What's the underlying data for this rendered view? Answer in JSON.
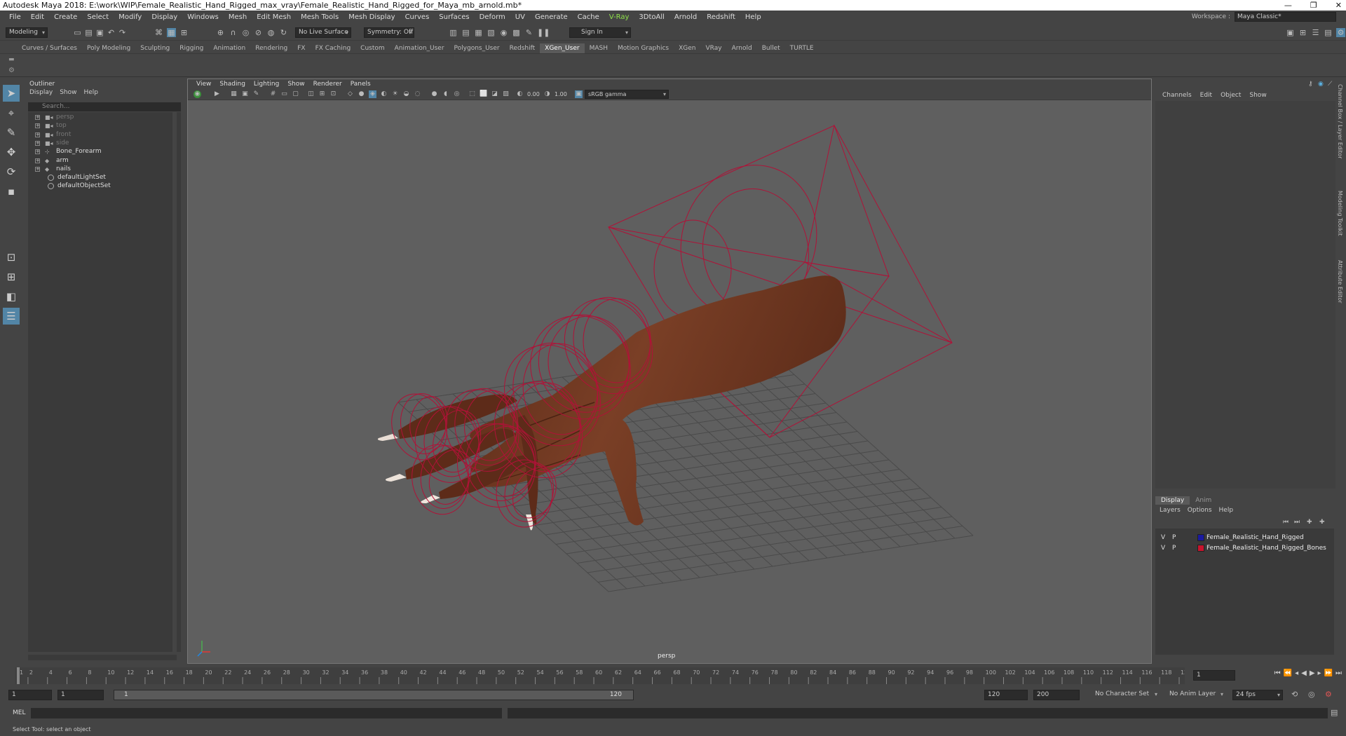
{
  "window": {
    "title": "Autodesk Maya 2018: E:\\work\\WIP\\Female_Realistic_Hand_Rigged_max_vray\\Female_Realistic_Hand_Rigged_for_Maya_mb_arnold.mb*",
    "min": "—",
    "restore": "❐",
    "close": "✕"
  },
  "menubar": [
    "File",
    "Edit",
    "Create",
    "Select",
    "Modify",
    "Display",
    "Windows",
    "Mesh",
    "Edit Mesh",
    "Mesh Tools",
    "Mesh Display",
    "Curves",
    "Surfaces",
    "Deform",
    "UV",
    "Generate",
    "Cache",
    "V-Ray",
    "3DtoAll",
    "Arnold",
    "Redshift",
    "Help"
  ],
  "workspace": {
    "label": "Workspace :",
    "value": "Maya Classic*"
  },
  "statusline": {
    "mode": "Modeling",
    "live_surface": "No Live Surface",
    "symmetry": "Symmetry: Off",
    "sign_in": "Sign In"
  },
  "shelf_tabs": [
    "Curves / Surfaces",
    "Poly Modeling",
    "Sculpting",
    "Rigging",
    "Animation",
    "Rendering",
    "FX",
    "FX Caching",
    "Custom",
    "Animation_User",
    "Polygons_User",
    "Redshift",
    "XGen_User",
    "MASH",
    "Motion Graphics",
    "XGen",
    "VRay",
    "Arnold",
    "Bullet",
    "TURTLE"
  ],
  "shelf_active": "XGen_User",
  "outliner": {
    "title": "Outliner",
    "menu": [
      "Display",
      "Show",
      "Help"
    ],
    "search_placeholder": "Search...",
    "items": [
      {
        "label": "persp",
        "dim": true
      },
      {
        "label": "top",
        "dim": true
      },
      {
        "label": "front",
        "dim": true
      },
      {
        "label": "side",
        "dim": true
      },
      {
        "label": "Bone_Forearm",
        "dim": false
      },
      {
        "label": "arm",
        "dim": false
      },
      {
        "label": "nails",
        "dim": false
      },
      {
        "label": "defaultLightSet",
        "dim": false
      },
      {
        "label": "defaultObjectSet",
        "dim": false
      }
    ]
  },
  "viewport": {
    "menu": [
      "View",
      "Shading",
      "Lighting",
      "Show",
      "Renderer",
      "Panels"
    ],
    "exposure": "0.00",
    "gamma": "1.00",
    "color_space": "sRGB gamma",
    "camera": "persp"
  },
  "channelbox": {
    "menu": [
      "Channels",
      "Edit",
      "Object",
      "Show"
    ]
  },
  "layer_editor": {
    "tabs": [
      "Display",
      "Anim"
    ],
    "menu": [
      "Layers",
      "Options",
      "Help"
    ],
    "layers": [
      {
        "v": "V",
        "p": "P",
        "color": "#1a1aa0",
        "name": "Female_Realistic_Hand_Rigged"
      },
      {
        "v": "V",
        "p": "P",
        "color": "#c8142d",
        "name": "Female_Realistic_Hand_Rigged_Bones"
      }
    ]
  },
  "side_tabs": [
    "Channel Box / Layer Editor",
    "Modeling Toolkit",
    "Attribute Editor"
  ],
  "timeline": {
    "tick_labels": [
      "1",
      "2",
      "4",
      "6",
      "8",
      "10",
      "12",
      "14",
      "16",
      "18",
      "20",
      "22",
      "24",
      "26",
      "28",
      "30",
      "32",
      "34",
      "36",
      "38",
      "40",
      "42",
      "44",
      "46",
      "48",
      "50",
      "52",
      "54",
      "56",
      "58",
      "60",
      "62",
      "64",
      "66",
      "68",
      "70",
      "72",
      "74",
      "76",
      "78",
      "80",
      "82",
      "84",
      "86",
      "88",
      "90",
      "92",
      "94",
      "96",
      "98",
      "100",
      "102",
      "104",
      "106",
      "108",
      "110",
      "112",
      "114",
      "116",
      "118",
      "120"
    ],
    "current_frame": "1"
  },
  "range": {
    "start": "1",
    "anim_start": "1",
    "range_start_label": "1",
    "range_end_label": "120",
    "end": "120",
    "anim_end": "200",
    "character_set": "No Character Set",
    "anim_layer": "No Anim Layer",
    "fps": "24 fps"
  },
  "cmdline": {
    "label": "MEL"
  },
  "helpline": "Select Tool: select an object",
  "colors": {
    "bg": "#444444",
    "viewport": "#5f5f5f",
    "wire": "#c8143c",
    "skin": "#6b3521",
    "accent": "#5285a6"
  }
}
